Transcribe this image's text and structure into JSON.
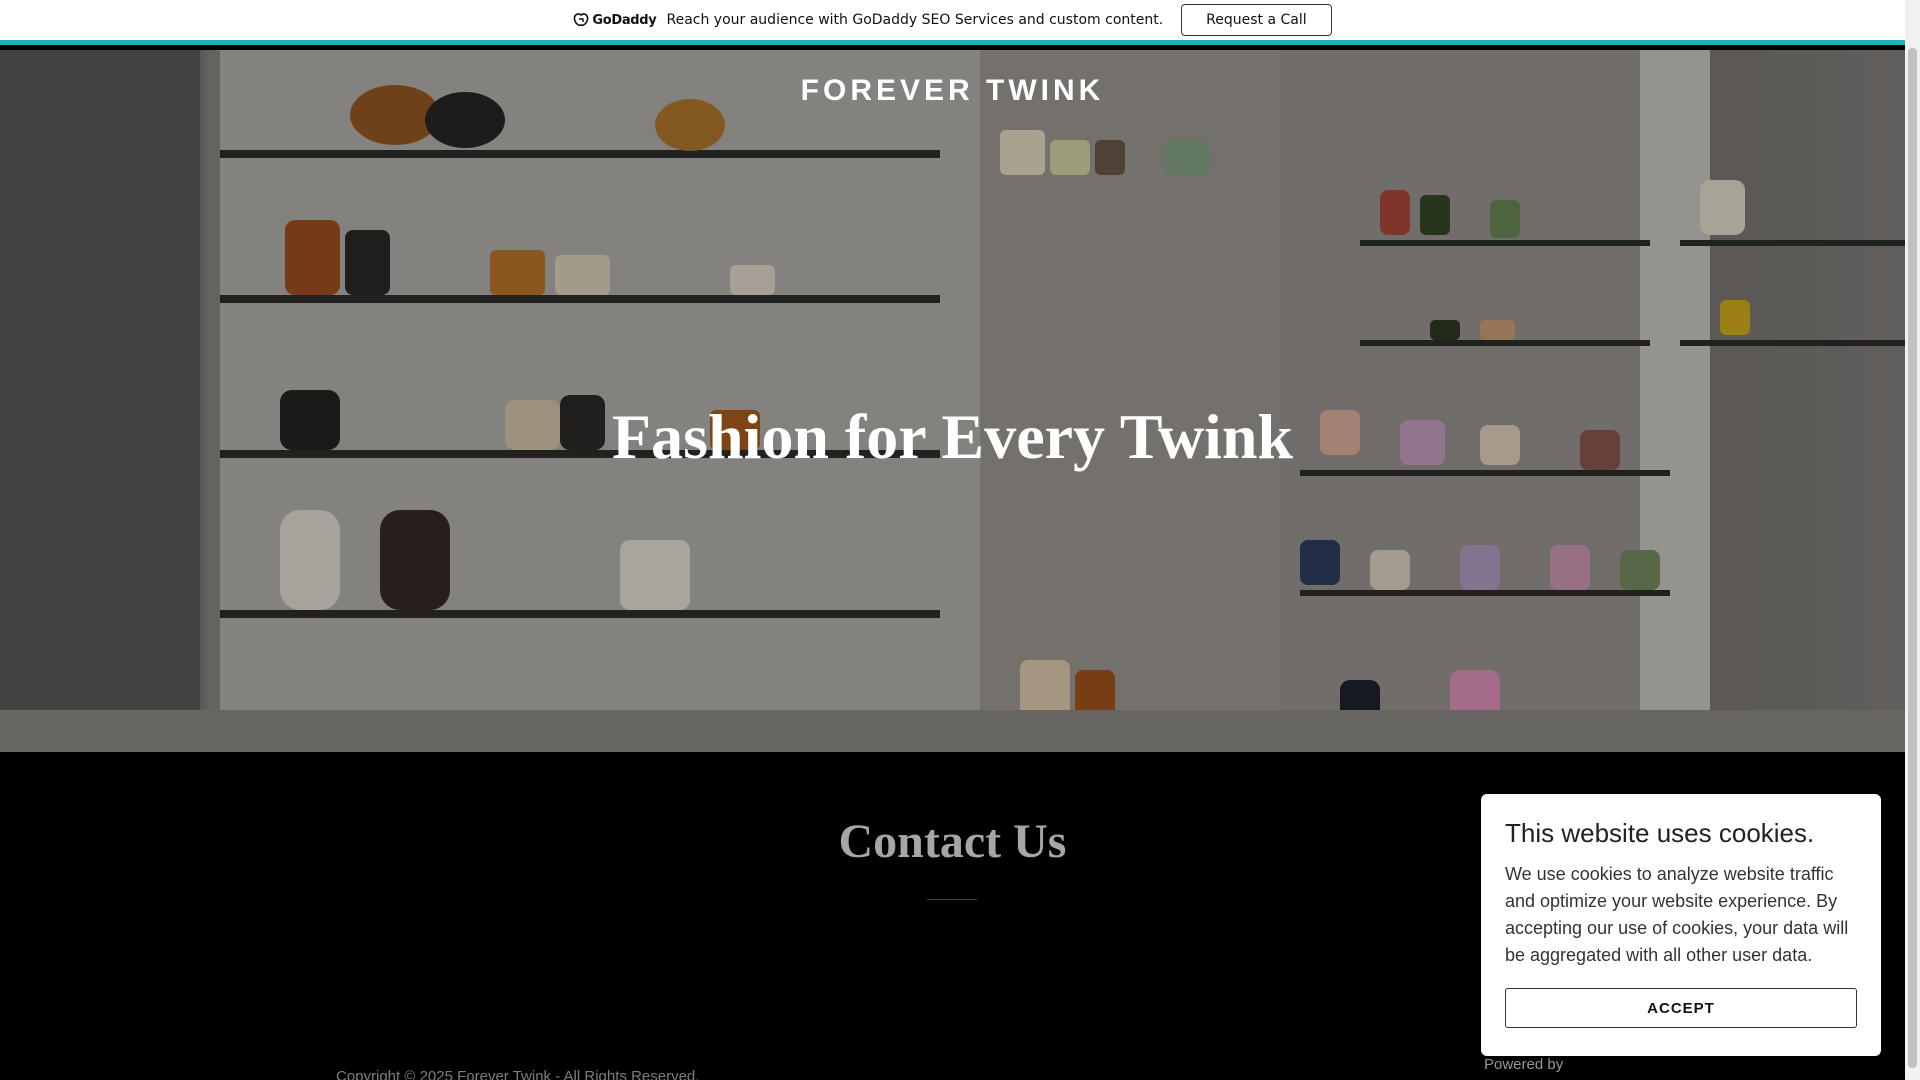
{
  "promo": {
    "logo_text": "GoDaddy",
    "message": "Reach your audience with GoDaddy SEO Services and custom content.",
    "button_label": "Request a Call"
  },
  "header": {
    "brand": "FOREVER TWINK"
  },
  "hero": {
    "heading": "Fashion for Every Twink"
  },
  "contact": {
    "title": "Contact Us"
  },
  "footer": {
    "copyright": "Copyright © 2025 Forever Twink - All Rights Reserved.",
    "powered_by": "Powered by"
  },
  "cookie_dialog": {
    "title": "This website uses cookies.",
    "body": "We use cookies to analyze website traffic and optimize your website experience. By accepting our use of cookies, your data will be aggregated with all other user data.",
    "accept_label": "ACCEPT"
  }
}
